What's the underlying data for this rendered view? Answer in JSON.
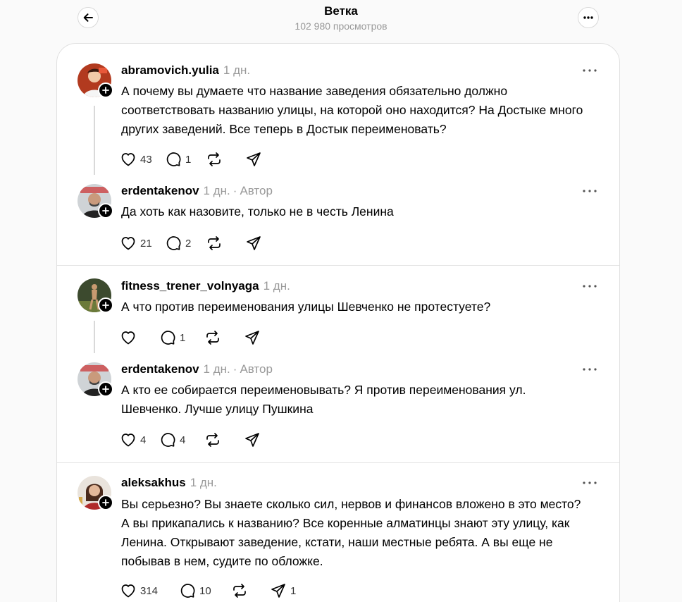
{
  "header": {
    "title": "Ветка",
    "views": "102 980 просмотров",
    "back_icon": "arrow-left-icon",
    "more_icon": "more-horizontal-icon"
  },
  "posts": [
    {
      "username": "abramovich.yulia",
      "time": "1 дн.",
      "author_label": "",
      "text": "А почему вы думаете что название заведения обязательно должно соответствовать названию улицы, на которой оно находится? На Достыке много других заведений. Все теперь в Достык переименовать?",
      "likes": "43",
      "replies": "1",
      "reposts": "",
      "shares": ""
    },
    {
      "username": "erdentakenov",
      "time": "1 дн.",
      "author_label": "Автор",
      "text": "Да хоть как назовите, только не в честь Ленина",
      "likes": "21",
      "replies": "2",
      "reposts": "",
      "shares": ""
    },
    {
      "username": "fitness_trener_volnyaga",
      "time": "1 дн.",
      "author_label": "",
      "text": "А что против переименования улицы Шевченко не протестуете?",
      "likes": "",
      "replies": "1",
      "reposts": "",
      "shares": ""
    },
    {
      "username": "erdentakenov",
      "time": "1 дн.",
      "author_label": "Автор",
      "text": "А кто ее собирается переименовывать? Я против переименования ул. Шевченко. Лучше улицу Пушкина",
      "likes": "4",
      "replies": "4",
      "reposts": "",
      "shares": ""
    },
    {
      "username": "aleksakhus",
      "time": "1 дн.",
      "author_label": "",
      "text": "Вы серьезно? Вы знаете сколько сил, нервов и финансов вложено в это место? А вы прикапались к названию? Все коренные алматинцы знают эту улицу, как Ленина. Открывают заведение, кстати, наши местные ребята. А вы еще не побывав в нем, судите по обложке.",
      "likes": "314",
      "replies": "10",
      "reposts": "",
      "shares": "1"
    }
  ],
  "colors": {
    "background": "#fafafa",
    "card": "#ffffff",
    "muted_text": "#999999",
    "divider": "#e3e3e3",
    "thread_line": "#d9d9d9"
  },
  "icons": {
    "like": "heart-icon",
    "reply": "comment-icon",
    "repost": "repost-icon",
    "share": "send-icon",
    "options": "more-dots-icon",
    "follow": "plus-icon"
  }
}
